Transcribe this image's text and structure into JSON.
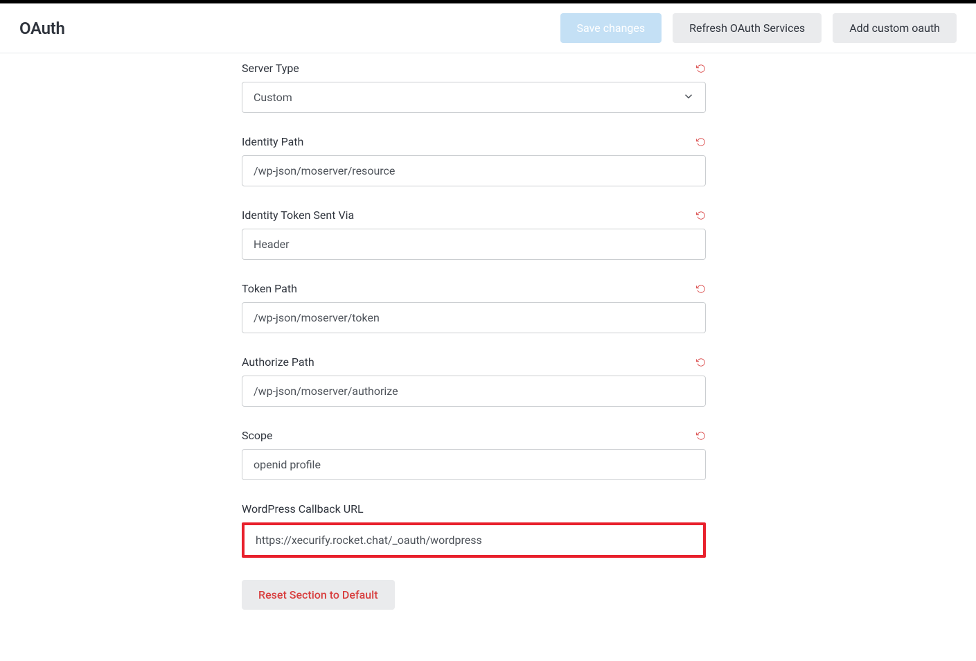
{
  "header": {
    "title": "OAuth",
    "save_button": "Save changes",
    "refresh_button": "Refresh OAuth Services",
    "add_custom_button": "Add custom oauth"
  },
  "fields": {
    "server_type": {
      "label": "Server Type",
      "value": "Custom"
    },
    "identity_path": {
      "label": "Identity Path",
      "value": "/wp-json/moserver/resource"
    },
    "identity_token_sent_via": {
      "label": "Identity Token Sent Via",
      "value": "Header"
    },
    "token_path": {
      "label": "Token Path",
      "value": "/wp-json/moserver/token"
    },
    "authorize_path": {
      "label": "Authorize Path",
      "value": "/wp-json/moserver/authorize"
    },
    "scope": {
      "label": "Scope",
      "value": "openid profile"
    },
    "callback_url": {
      "label": "WordPress Callback URL",
      "value": "https://xecurify.rocket.chat/_oauth/wordpress"
    }
  },
  "reset_section_button": "Reset Section to Default"
}
